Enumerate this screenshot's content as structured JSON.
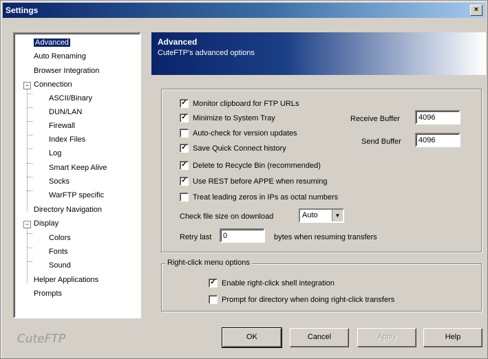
{
  "window": {
    "title": "Settings",
    "close_label": "×"
  },
  "tree": {
    "items": [
      "Advanced",
      "Auto Renaming",
      "Browser Integration",
      "Connection",
      "ASCII/Binary",
      "DUN/LAN",
      "Firewall",
      "Index Files",
      "Log",
      "Smart Keep Alive",
      "Socks",
      "WarFTP specific",
      "Directory Navigation",
      "Display",
      "Colors",
      "Fonts",
      "Sound",
      "Helper Applications",
      "Prompts"
    ],
    "expander_symbol": "−"
  },
  "brand": "CuteFTP",
  "header": {
    "title": "Advanced",
    "subtitle": "CuteFTP's advanced options"
  },
  "options": {
    "checkboxes": [
      {
        "label": "Monitor clipboard for FTP URLs",
        "checked": true
      },
      {
        "label": "Minimize to System Tray",
        "checked": true
      },
      {
        "label": "Auto-check for version updates",
        "checked": false
      },
      {
        "label": "Save Quick Connect history",
        "checked": true
      },
      {
        "label": "Delete to Recycle Bin (recommended)",
        "checked": true
      },
      {
        "label": "Use REST before APPE when resuming",
        "checked": true
      },
      {
        "label": "Treat leading zeros in IPs as octal numbers",
        "checked": false
      }
    ],
    "receive_buffer_label": "Receive Buffer",
    "receive_buffer_value": "4096",
    "send_buffer_label": "Send Buffer",
    "send_buffer_value": "4096",
    "check_file_size_label": "Check file size on download",
    "check_file_size_value": "Auto",
    "retry_label": "Retry last",
    "retry_value": "0",
    "retry_suffix": "bytes when resuming transfers"
  },
  "right_click": {
    "group_label": "Right-click menu options",
    "checkboxes": [
      {
        "label": "Enable right-click shell integration",
        "checked": true
      },
      {
        "label": "Prompt for directory when doing right-click transfers",
        "checked": false
      }
    ]
  },
  "buttons": {
    "ok": "OK",
    "cancel": "Cancel",
    "apply": "Apply",
    "help": "Help"
  },
  "check_mark": "✓",
  "arrow_down": "▼"
}
